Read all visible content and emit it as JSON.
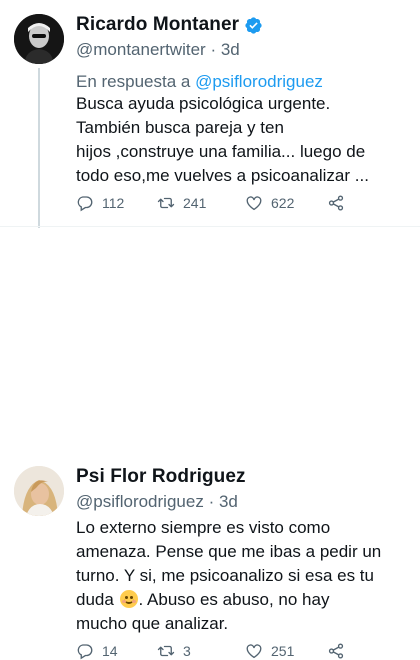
{
  "tweets": [
    {
      "name": "Ricardo Montaner",
      "verified": true,
      "handle": "@montanertwiter",
      "sep": "·",
      "time": "3d",
      "reply_prefix": "En respuesta a",
      "reply_mention": "@psiflorodriguez",
      "text": "Busca ayuda psicológica urgente.\nTambién busca pareja y ten\nhijos ,construye una familia... luego de\ntodo eso,me vuelves a psicoanalizar ...",
      "replies": "112",
      "retweets": "241",
      "likes": "622"
    },
    {
      "name": "Psi Flor Rodriguez",
      "verified": false,
      "handle": "@psiflorodriguez",
      "sep": "·",
      "time": "3d",
      "text_before_emoji": "Lo externo siempre es visto como\namenaza. Pense que me ibas a pedir un\nturno. Y si, me psicoanalizo si esa es tu\nduda ",
      "emoji": "smiling-face-emoji",
      "text_after_emoji": ". Abuso es abuso, no hay\nmucho que analizar.",
      "replies": "14",
      "retweets": "3",
      "likes": "251"
    }
  ],
  "colors": {
    "accent": "#1d9bf0",
    "secondary_text": "#536471",
    "primary_text": "#0f1419"
  }
}
